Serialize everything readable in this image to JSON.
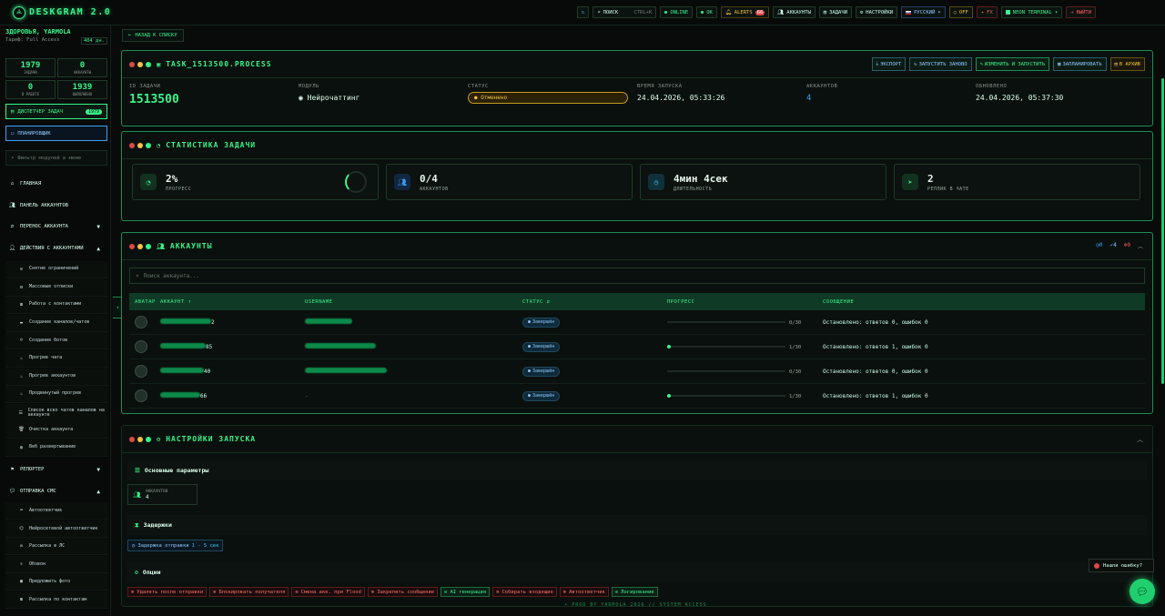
{
  "topbar": {
    "logo": "DESKGRAM 2.0",
    "search_label": "ПОИСК",
    "search_shortcut": "CTRL+K",
    "online": "ONLINE",
    "ok": "OK",
    "alerts": "ALERTS",
    "alerts_count": "66",
    "accounts": "АККАУНТЫ",
    "tasks": "ЗАДАЧИ",
    "settings": "НАСТРОЙКИ",
    "language": "РУССКИЙ",
    "off": "OFF",
    "fx": "FX",
    "theme": "NEON TERMINAL",
    "logout": "ВЫЙТИ"
  },
  "sidebar": {
    "user": "ЗДОРОВЬЯ, YARMOLA",
    "tariff": "Тариф: Full Access",
    "days": "404 дн.",
    "stats": [
      {
        "value": "1979",
        "label": "ЗАДАЧИ"
      },
      {
        "value": "0",
        "label": "АККАУНТЫ"
      },
      {
        "value": "0",
        "label": "В РАБОТЕ"
      },
      {
        "value": "1939",
        "label": "ВЫПОЛНЕНО"
      }
    ],
    "dispatcher": "ДИСПЕТЧЕР ЗАДАЧ",
    "dispatcher_badge": "1979",
    "planner": "ПЛАНИРОВЩИК",
    "filter_placeholder": "Фильтр модулей в меню",
    "nav": [
      "ГЛАВНАЯ",
      "ПАНЕЛЬ АККАУНТОВ",
      "ПЕРЕНОС АККАУНТА",
      "ДЕЙСТВИЯ С АККАУНТАМИ"
    ],
    "sub1": [
      "Снятие ограничений",
      "Массовые отписки",
      "Работа с контактами",
      "Создание каналов/чатов",
      "Создание ботов",
      "Прогрев чата",
      "Прогрев аккаунтов",
      "Продвинутый прогрев",
      "Список всех чатов каналов на аккаунте",
      "Очистка аккаунта",
      "Веб развертывание"
    ],
    "nav2": [
      "РЕПОРТЕР",
      "ОТПРАВКА СМС"
    ],
    "sub2": [
      "Автоответчик",
      "Нейросетевой автоответчик",
      "Рассылка в ЛС",
      "Обзвон",
      "Предложить фото",
      "Рассылка по контактам"
    ]
  },
  "main": {
    "back": "НАЗАД К СПИСКУ",
    "task_title": "TASK_1513500.PROCESS",
    "actions": [
      "ЭКСПОРТ",
      "ЗАПУСТИТЬ ЗАНОВО",
      "ИЗМЕНИТЬ И ЗАПУСТИТЬ",
      "ЗАПЛАНИРОВАТЬ",
      "В АРХИВ"
    ],
    "info": [
      {
        "label": "ID ЗАДАЧИ",
        "value": "1513500"
      },
      {
        "label": "МОДУЛЬ",
        "value": "Нейрочаттинг"
      },
      {
        "label": "СТАТУС",
        "value": "Отменено"
      },
      {
        "label": "ВРЕМЯ ЗАПУСКА",
        "value": "24.04.2026, 05:33:26"
      },
      {
        "label": "АККАУНТОВ",
        "value": "4"
      },
      {
        "label": "ОБНОВЛЕНО",
        "value": "24.04.2026, 05:37:30"
      }
    ],
    "stats_title": "СТАТИСТИКА ЗАДАЧИ",
    "stats": [
      {
        "value": "2%",
        "label": "ПРОГРЕСС",
        "fill": 0.02
      },
      {
        "value": "0/4",
        "label": "АККАУНТОВ"
      },
      {
        "value": "4мин 4сек",
        "label": "ДЛИТЕЛЬНОСТЬ"
      },
      {
        "value": "2",
        "label": "РЕПЛИК В ЧАТЕ"
      }
    ],
    "accounts_title": "АККАУНТЫ",
    "counts": [
      "0",
      "4",
      "0"
    ],
    "acc_search_placeholder": "Поиск аккаунта...",
    "columns": [
      "АВАТАР",
      "АККАУНТ",
      "USERNAME",
      "СТАТУС",
      "ПРОГРЕСС",
      "СООБЩЕНИЕ"
    ],
    "rows": [
      {
        "acc_suffix": "2",
        "username": "",
        "status": "Завершён",
        "progress": "0/30",
        "fill": 0,
        "message": "Остановлено: ответов 0, ошибок 0"
      },
      {
        "acc_suffix": "85",
        "username": "",
        "status": "Завершён",
        "progress": "1/30",
        "fill": 0.03,
        "message": "Остановлено: ответов 1, ошибок 0"
      },
      {
        "acc_suffix": "40",
        "username": "",
        "status": "Завершён",
        "progress": "0/30",
        "fill": 0,
        "message": "Остановлено: ответов 0, ошибок 0"
      },
      {
        "acc_suffix": "66",
        "username": "-",
        "status": "Завершён",
        "progress": "1/30",
        "fill": 0.03,
        "message": "Остановлено: ответов 1, ошибок 0"
      }
    ],
    "launch_title": "НАСТРОЙКИ ЗАПУСКА",
    "basic": "Основные параметры",
    "acc_box_label": "АККАУНТОВ",
    "acc_box_value": "4",
    "delays": "Задержки",
    "delay_label": "Задержка отправки",
    "delay_value": "1 - 5 сек",
    "options": "Опции",
    "chips": [
      {
        "label": "Удалять после отправки",
        "on": false
      },
      {
        "label": "Блокировать получателя",
        "on": false
      },
      {
        "label": "Смена акк. при Flood",
        "on": false
      },
      {
        "label": "Закрепить сообщение",
        "on": false
      },
      {
        "label": "AI генерация",
        "on": true
      },
      {
        "label": "Собирать входящие",
        "on": false
      },
      {
        "label": "Автоответчик",
        "on": false
      },
      {
        "label": "Логирование",
        "on": true
      }
    ],
    "footer": "• PROD BY YARMOLA 2026   // SYSTEM ACCESS",
    "bug": "Нашли ошибку?"
  }
}
